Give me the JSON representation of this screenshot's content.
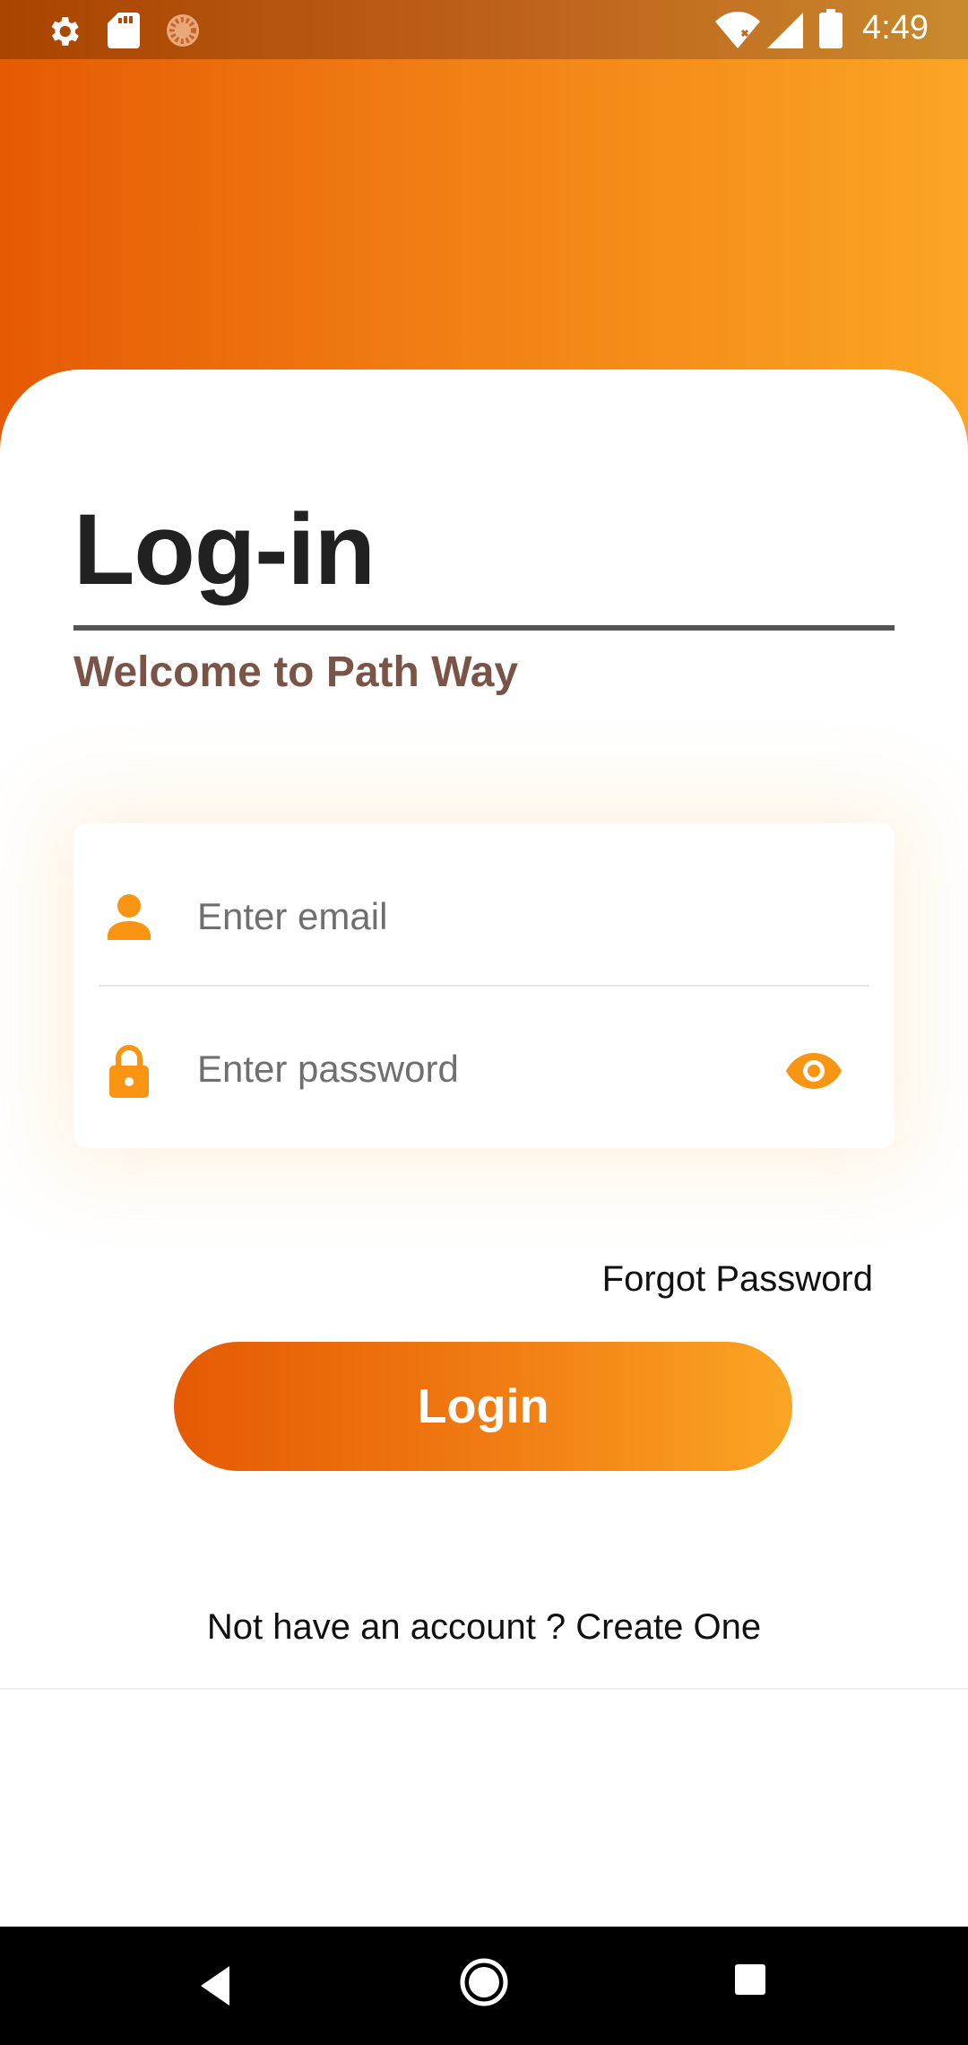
{
  "status_bar": {
    "time": "4:49",
    "left_icons": [
      "gear-icon",
      "sd-card-icon",
      "circle-loader-icon"
    ],
    "right_icons": [
      "wifi-icon",
      "signal-icon",
      "battery-icon"
    ]
  },
  "login": {
    "title": "Log-in",
    "subtitle": "Welcome to Path Way",
    "email_placeholder": "Enter email",
    "password_placeholder": "Enter password",
    "forgot_label": "Forgot Password",
    "login_label": "Login",
    "signup_prompt": "Not have an account ? ",
    "signup_link": "Create One"
  },
  "colors": {
    "accent": "#fa9514",
    "gradient_start": "#e55a03",
    "gradient_end": "#fba524",
    "subtitle": "#7b5448"
  },
  "nav_bar": {
    "buttons": [
      "back-icon",
      "home-icon",
      "recents-icon"
    ]
  }
}
